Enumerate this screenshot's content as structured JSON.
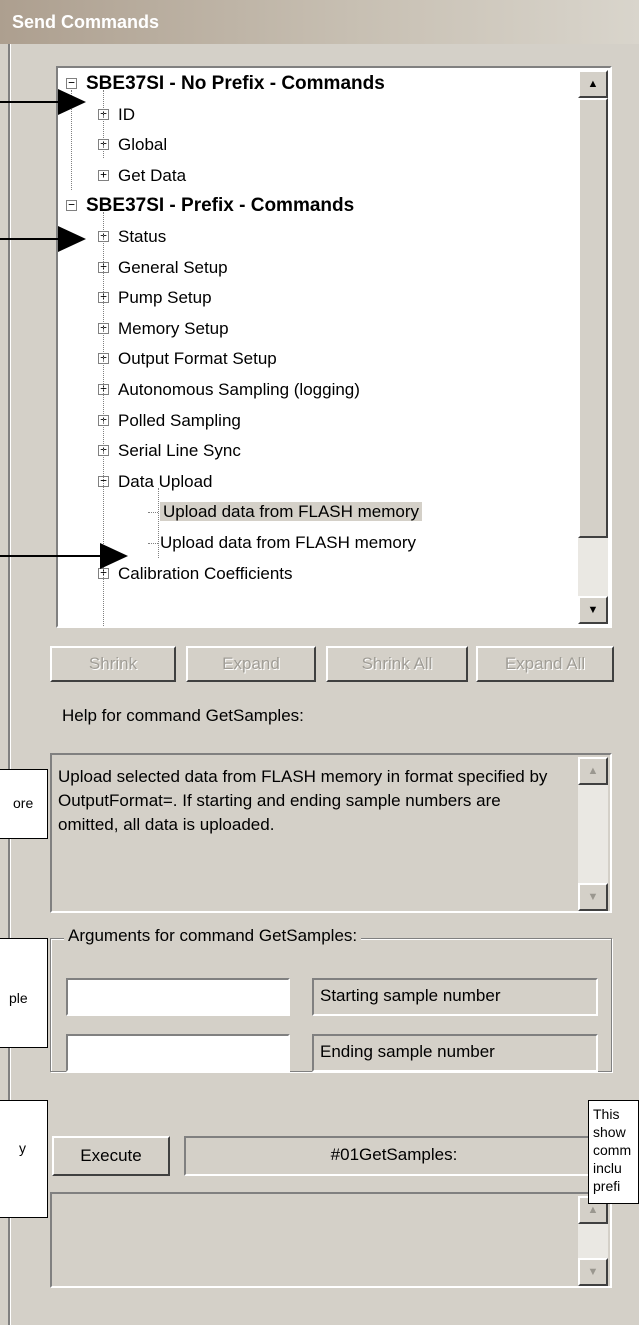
{
  "window": {
    "title": "Send Commands"
  },
  "tree": {
    "nodes": [
      {
        "label": "SBE37SI - No Prefix - Commands",
        "expander": "−"
      },
      {
        "label": "ID",
        "expander": "+"
      },
      {
        "label": "Global",
        "expander": "+"
      },
      {
        "label": "Get Data",
        "expander": "+"
      },
      {
        "label": "SBE37SI - Prefix - Commands",
        "expander": "−"
      },
      {
        "label": "Status",
        "expander": "+"
      },
      {
        "label": "General Setup",
        "expander": "+"
      },
      {
        "label": "Pump Setup",
        "expander": "+"
      },
      {
        "label": "Memory Setup",
        "expander": "+"
      },
      {
        "label": "Output Format Setup",
        "expander": "+"
      },
      {
        "label": "Autonomous Sampling (logging)",
        "expander": "+"
      },
      {
        "label": "Polled Sampling",
        "expander": "+"
      },
      {
        "label": "Serial Line Sync",
        "expander": "+"
      },
      {
        "label": "Data Upload",
        "expander": "−"
      },
      {
        "label": "Upload data from FLASH memory"
      },
      {
        "label": "Upload data from FLASH memory"
      },
      {
        "label": "Calibration Coefficients",
        "expander": "+"
      }
    ],
    "selected_index": 14
  },
  "scroll_arrows": {
    "up": "▲",
    "down": "▼"
  },
  "tree_buttons": {
    "shrink": "Shrink",
    "expand": "Expand",
    "shrink_all": "Shrink All",
    "expand_all": "Expand All"
  },
  "help": {
    "heading": "Help for command GetSamples:",
    "text": "Upload selected data from FLASH memory in format specified by OutputFormat=. If starting and ending sample numbers are omitted, all data is uploaded."
  },
  "arguments": {
    "title": "Arguments for command GetSamples:",
    "fields": [
      {
        "value": "",
        "label": "Starting sample number"
      },
      {
        "value": "",
        "label": "Ending sample number"
      }
    ]
  },
  "execute": {
    "button_label": "Execute",
    "command_preview": "#01GetSamples:"
  },
  "callouts": {
    "help_partial": "ore",
    "arguments_partial": "ple",
    "execute_partial": "y",
    "command_partial_lines": [
      "This",
      "show",
      "comm",
      "inclu",
      "prefi"
    ]
  }
}
